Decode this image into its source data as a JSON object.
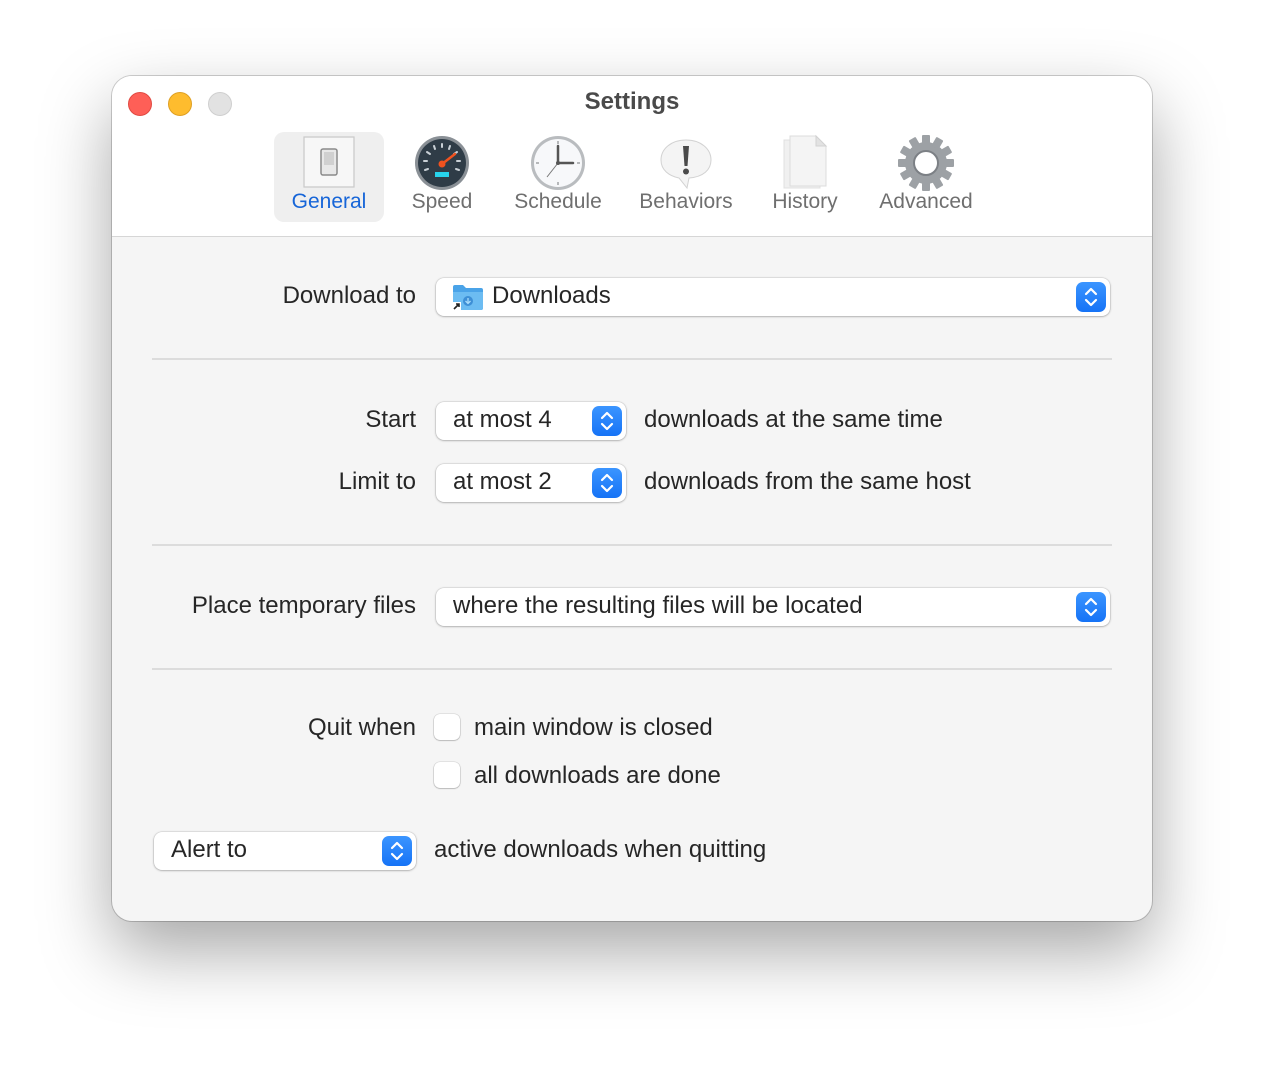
{
  "window": {
    "title": "Settings",
    "traffic_lights": [
      "close",
      "minimize",
      "zoom"
    ]
  },
  "tabs": [
    {
      "label": "General",
      "icon": "light-switch-icon",
      "active": true
    },
    {
      "label": "Speed",
      "icon": "speedometer-icon",
      "active": false
    },
    {
      "label": "Schedule",
      "icon": "clock-icon",
      "active": false
    },
    {
      "label": "Behaviors",
      "icon": "exclamation-bubble-icon",
      "active": false
    },
    {
      "label": "History",
      "icon": "document-icon",
      "active": false
    },
    {
      "label": "Advanced",
      "icon": "gear-icon",
      "active": false
    }
  ],
  "general": {
    "download_to": {
      "label": "Download to",
      "value": "Downloads",
      "icon": "downloads-folder-icon"
    },
    "start": {
      "label": "Start",
      "value": "at most 4",
      "suffix": "downloads at the same time"
    },
    "limit": {
      "label": "Limit to",
      "value": "at most 2",
      "suffix": "downloads from the same host"
    },
    "temp_files": {
      "label": "Place temporary files",
      "value": "where the resulting files will be located"
    },
    "quit_when": {
      "label": "Quit when",
      "options": [
        {
          "label": "main window is closed",
          "checked": false
        },
        {
          "label": "all downloads are done",
          "checked": false
        }
      ]
    },
    "alert": {
      "value": "Alert to",
      "suffix": "active downloads when quitting"
    }
  },
  "colors": {
    "accent": "#1673f6",
    "active_tab_text": "#1665d8",
    "close": "#fe5f57",
    "minimize": "#febc2e",
    "zoom_inactive": "#e2e2e2"
  }
}
